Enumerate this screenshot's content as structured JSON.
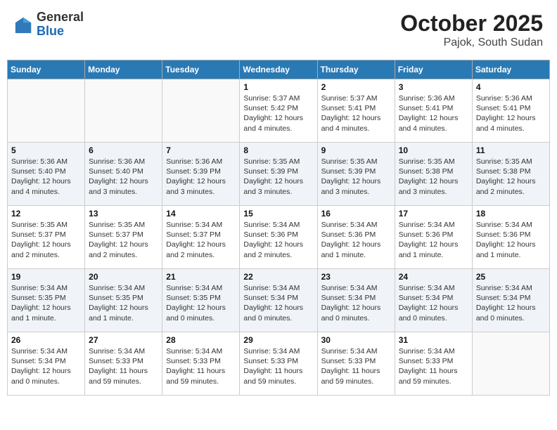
{
  "logo": {
    "general": "General",
    "blue": "Blue"
  },
  "title": "October 2025",
  "subtitle": "Pajok, South Sudan",
  "weekdays": [
    "Sunday",
    "Monday",
    "Tuesday",
    "Wednesday",
    "Thursday",
    "Friday",
    "Saturday"
  ],
  "weeks": [
    [
      {
        "day": "",
        "info": ""
      },
      {
        "day": "",
        "info": ""
      },
      {
        "day": "",
        "info": ""
      },
      {
        "day": "1",
        "info": "Sunrise: 5:37 AM\nSunset: 5:42 PM\nDaylight: 12 hours\nand 4 minutes."
      },
      {
        "day": "2",
        "info": "Sunrise: 5:37 AM\nSunset: 5:41 PM\nDaylight: 12 hours\nand 4 minutes."
      },
      {
        "day": "3",
        "info": "Sunrise: 5:36 AM\nSunset: 5:41 PM\nDaylight: 12 hours\nand 4 minutes."
      },
      {
        "day": "4",
        "info": "Sunrise: 5:36 AM\nSunset: 5:41 PM\nDaylight: 12 hours\nand 4 minutes."
      }
    ],
    [
      {
        "day": "5",
        "info": "Sunrise: 5:36 AM\nSunset: 5:40 PM\nDaylight: 12 hours\nand 4 minutes."
      },
      {
        "day": "6",
        "info": "Sunrise: 5:36 AM\nSunset: 5:40 PM\nDaylight: 12 hours\nand 3 minutes."
      },
      {
        "day": "7",
        "info": "Sunrise: 5:36 AM\nSunset: 5:39 PM\nDaylight: 12 hours\nand 3 minutes."
      },
      {
        "day": "8",
        "info": "Sunrise: 5:35 AM\nSunset: 5:39 PM\nDaylight: 12 hours\nand 3 minutes."
      },
      {
        "day": "9",
        "info": "Sunrise: 5:35 AM\nSunset: 5:39 PM\nDaylight: 12 hours\nand 3 minutes."
      },
      {
        "day": "10",
        "info": "Sunrise: 5:35 AM\nSunset: 5:38 PM\nDaylight: 12 hours\nand 3 minutes."
      },
      {
        "day": "11",
        "info": "Sunrise: 5:35 AM\nSunset: 5:38 PM\nDaylight: 12 hours\nand 2 minutes."
      }
    ],
    [
      {
        "day": "12",
        "info": "Sunrise: 5:35 AM\nSunset: 5:37 PM\nDaylight: 12 hours\nand 2 minutes."
      },
      {
        "day": "13",
        "info": "Sunrise: 5:35 AM\nSunset: 5:37 PM\nDaylight: 12 hours\nand 2 minutes."
      },
      {
        "day": "14",
        "info": "Sunrise: 5:34 AM\nSunset: 5:37 PM\nDaylight: 12 hours\nand 2 minutes."
      },
      {
        "day": "15",
        "info": "Sunrise: 5:34 AM\nSunset: 5:36 PM\nDaylight: 12 hours\nand 2 minutes."
      },
      {
        "day": "16",
        "info": "Sunrise: 5:34 AM\nSunset: 5:36 PM\nDaylight: 12 hours\nand 1 minute."
      },
      {
        "day": "17",
        "info": "Sunrise: 5:34 AM\nSunset: 5:36 PM\nDaylight: 12 hours\nand 1 minute."
      },
      {
        "day": "18",
        "info": "Sunrise: 5:34 AM\nSunset: 5:36 PM\nDaylight: 12 hours\nand 1 minute."
      }
    ],
    [
      {
        "day": "19",
        "info": "Sunrise: 5:34 AM\nSunset: 5:35 PM\nDaylight: 12 hours\nand 1 minute."
      },
      {
        "day": "20",
        "info": "Sunrise: 5:34 AM\nSunset: 5:35 PM\nDaylight: 12 hours\nand 1 minute."
      },
      {
        "day": "21",
        "info": "Sunrise: 5:34 AM\nSunset: 5:35 PM\nDaylight: 12 hours\nand 0 minutes."
      },
      {
        "day": "22",
        "info": "Sunrise: 5:34 AM\nSunset: 5:34 PM\nDaylight: 12 hours\nand 0 minutes."
      },
      {
        "day": "23",
        "info": "Sunrise: 5:34 AM\nSunset: 5:34 PM\nDaylight: 12 hours\nand 0 minutes."
      },
      {
        "day": "24",
        "info": "Sunrise: 5:34 AM\nSunset: 5:34 PM\nDaylight: 12 hours\nand 0 minutes."
      },
      {
        "day": "25",
        "info": "Sunrise: 5:34 AM\nSunset: 5:34 PM\nDaylight: 12 hours\nand 0 minutes."
      }
    ],
    [
      {
        "day": "26",
        "info": "Sunrise: 5:34 AM\nSunset: 5:34 PM\nDaylight: 12 hours\nand 0 minutes."
      },
      {
        "day": "27",
        "info": "Sunrise: 5:34 AM\nSunset: 5:33 PM\nDaylight: 11 hours\nand 59 minutes."
      },
      {
        "day": "28",
        "info": "Sunrise: 5:34 AM\nSunset: 5:33 PM\nDaylight: 11 hours\nand 59 minutes."
      },
      {
        "day": "29",
        "info": "Sunrise: 5:34 AM\nSunset: 5:33 PM\nDaylight: 11 hours\nand 59 minutes."
      },
      {
        "day": "30",
        "info": "Sunrise: 5:34 AM\nSunset: 5:33 PM\nDaylight: 11 hours\nand 59 minutes."
      },
      {
        "day": "31",
        "info": "Sunrise: 5:34 AM\nSunset: 5:33 PM\nDaylight: 11 hours\nand 59 minutes."
      },
      {
        "day": "",
        "info": ""
      }
    ]
  ]
}
